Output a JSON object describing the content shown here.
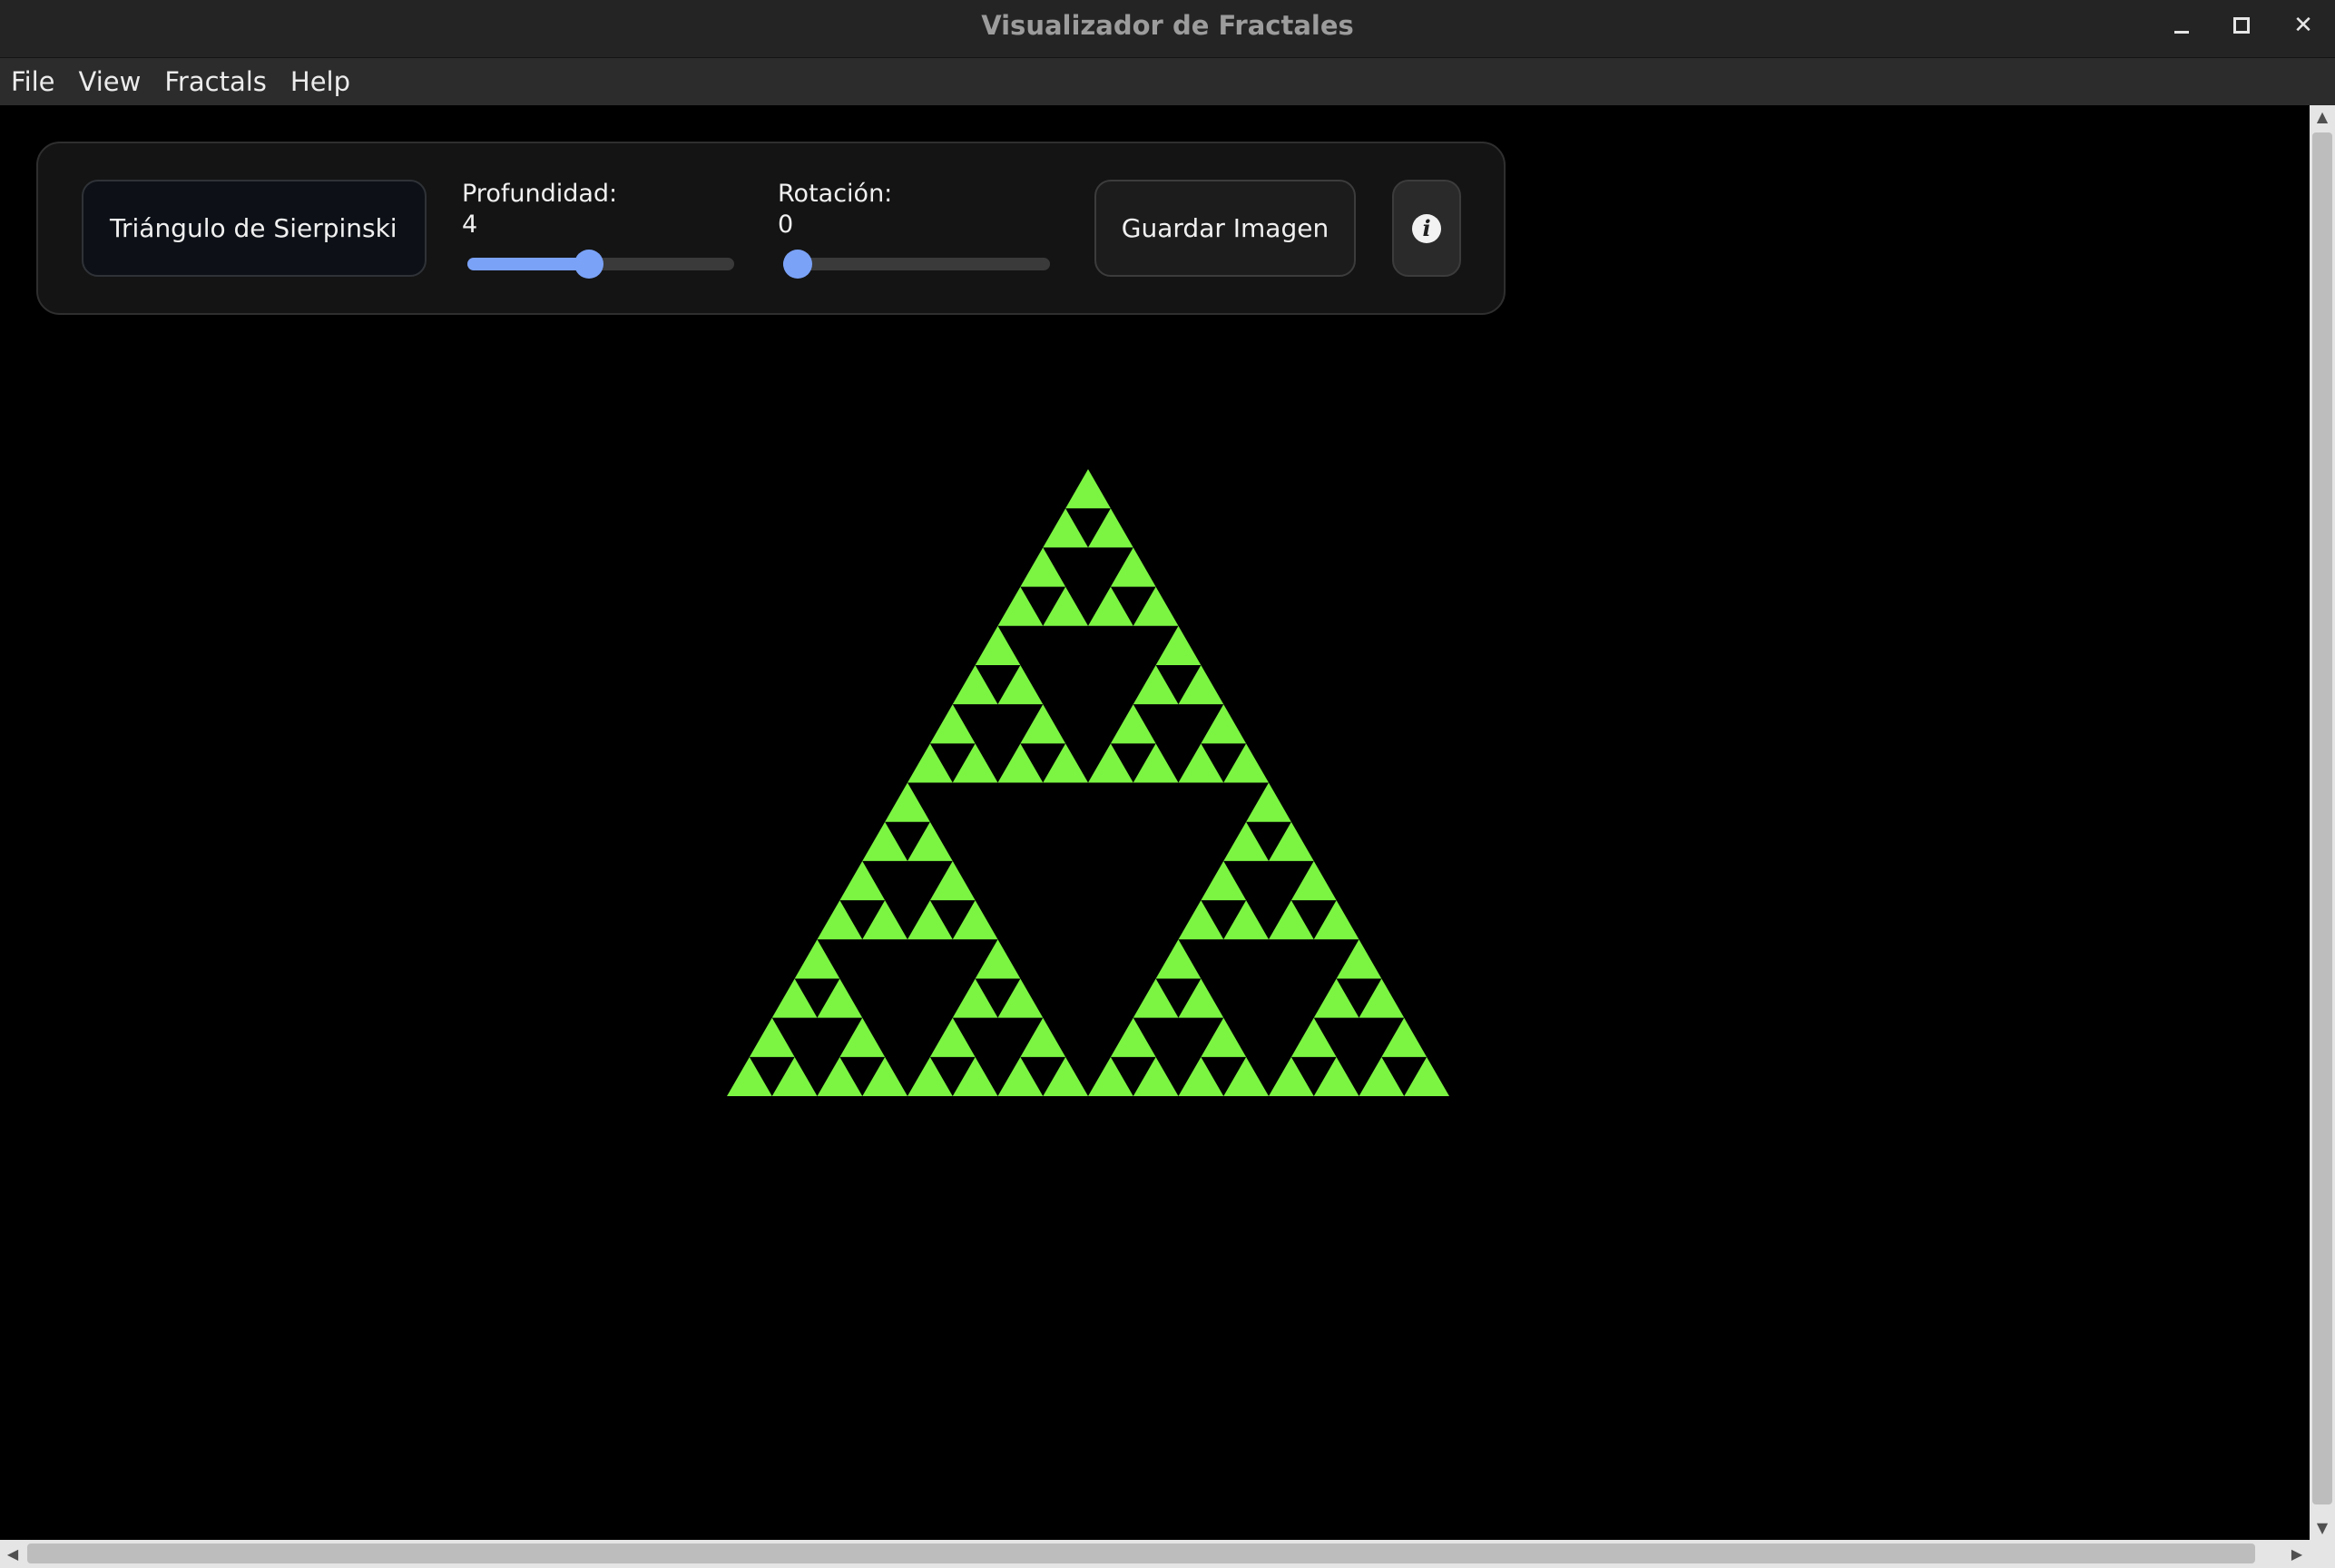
{
  "window": {
    "title": "Visualizador de Fractales",
    "minimize_icon": "minimize-icon",
    "maximize_icon": "maximize-icon",
    "close_icon": "close-icon",
    "close_glyph": "✕"
  },
  "menu": {
    "items": [
      "File",
      "View",
      "Fractals",
      "Help"
    ]
  },
  "controls": {
    "fractal_select": "Triángulo de Sierpinski",
    "depth": {
      "label": "Profundidad:",
      "value": "4",
      "fraction": 0.45
    },
    "rotation": {
      "label": "Rotación:",
      "value": "0",
      "fraction": 0.0
    },
    "save_button": "Guardar Imagen",
    "info_icon": "info-icon",
    "info_glyph": "i"
  },
  "colors": {
    "fractal_fill": "#7bf542",
    "accent": "#7aa2f7",
    "background": "#000000"
  },
  "fractal": {
    "type": "sierpinski-triangle",
    "depth": 4
  },
  "scrollbars": {
    "up": "▲",
    "down": "▼",
    "left": "◀",
    "right": "▶"
  }
}
